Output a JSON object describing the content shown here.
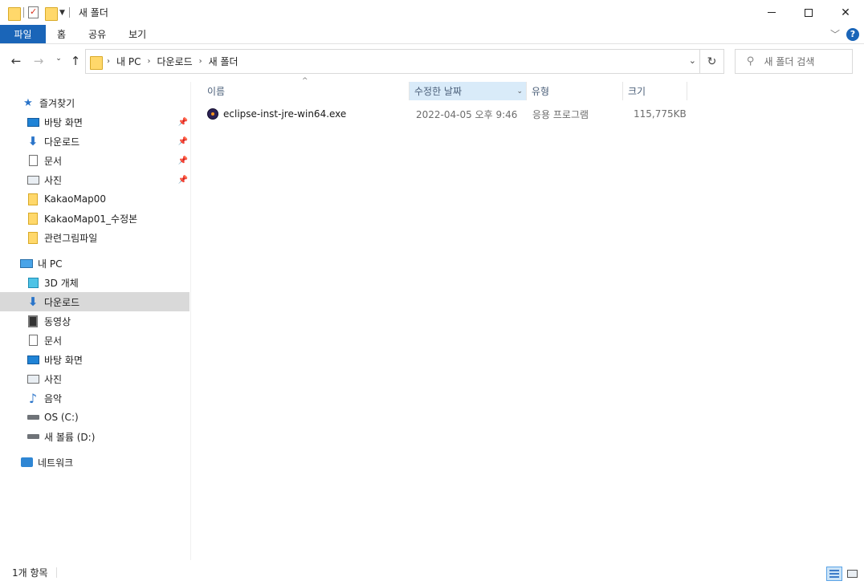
{
  "window": {
    "title": "새 폴더"
  },
  "ribbon": {
    "tabs": [
      "파일",
      "홈",
      "공유",
      "보기"
    ]
  },
  "address": {
    "crumbs": [
      "내 PC",
      "다운로드",
      "새 폴더"
    ]
  },
  "search": {
    "placeholder": "새 폴더 검색"
  },
  "nav": {
    "quick_access": "즐겨찾기",
    "quick_items": [
      "바탕 화면",
      "다운로드",
      "문서",
      "사진",
      "KakaoMap00",
      "KakaoMap01_수정본",
      "관련그림파일"
    ],
    "this_pc": "내 PC",
    "pc_items": [
      "3D 개체",
      "다운로드",
      "동영상",
      "문서",
      "바탕 화면",
      "사진",
      "음악",
      "OS (C:)",
      "새 볼륨 (D:)"
    ],
    "network": "네트워크"
  },
  "columns": {
    "name": "이름",
    "date": "수정한 날짜",
    "type": "유형",
    "size": "크기"
  },
  "files": [
    {
      "name": "eclipse-inst-jre-win64.exe",
      "date": "2022-04-05 오후 9:46",
      "type": "응용 프로그램",
      "size": "115,775KB"
    }
  ],
  "status": {
    "count": "1개 항목"
  },
  "colors": {
    "accent": "#1a65b8",
    "selected_nav": "#d9d9d9",
    "sorted_column": "#d9ebf9"
  }
}
